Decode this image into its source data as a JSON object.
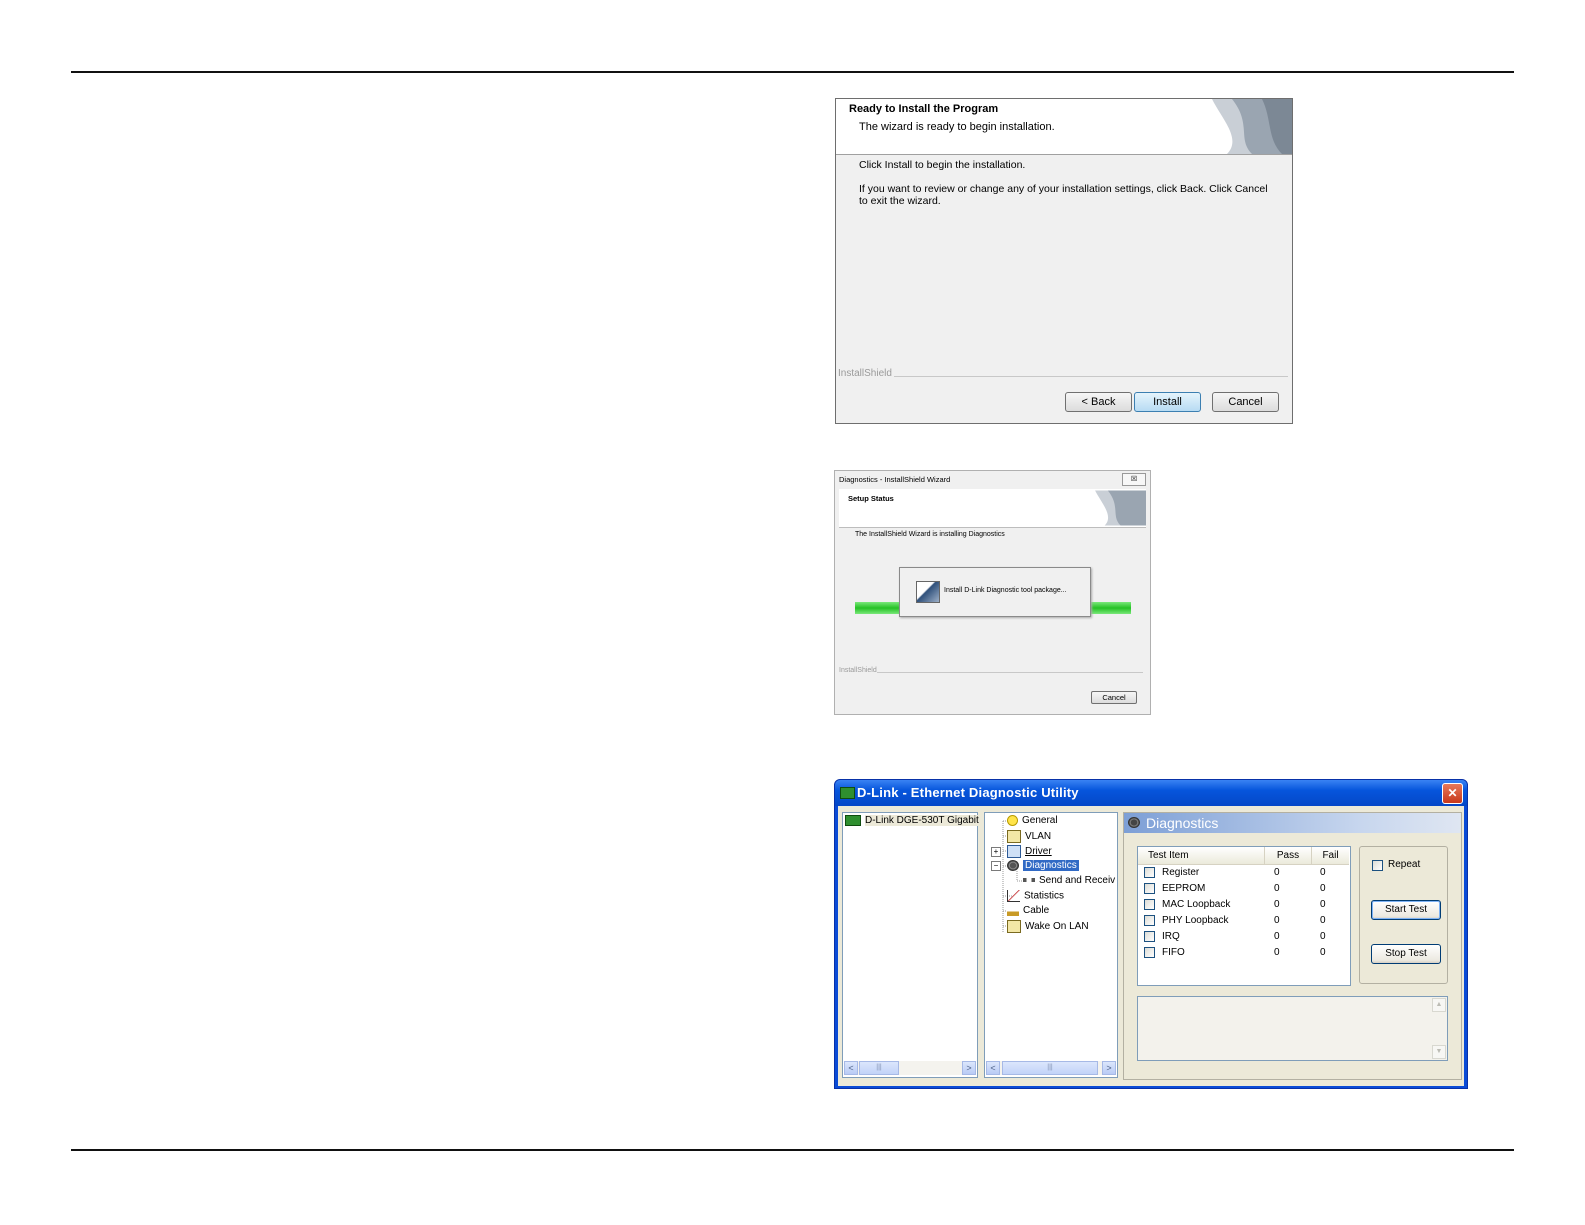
{
  "dialog1": {
    "title": "Ready to Install the Program",
    "subtitle": "The wizard is ready to begin installation.",
    "body_line1": "Click Install to begin the installation.",
    "body_line2": "If you want to review or change any of your installation settings, click Back. Click Cancel to exit the wizard.",
    "brand": "InstallShield",
    "buttons": {
      "back": "< Back",
      "install": "Install",
      "cancel": "Cancel"
    }
  },
  "dialog2": {
    "window_title": "Diagnostics - InstallShield Wizard",
    "close_glyph": "☒",
    "header_title": "Setup Status",
    "status_text": "The InstallShield Wizard is installing Diagnostics",
    "popup_message": "Install D-Link Diagnostic tool package...",
    "brand": "InstallShield",
    "cancel_label": "Cancel"
  },
  "utility": {
    "title": "D-Link - Ethernet Diagnostic Utility",
    "close_glyph": "✕",
    "adapter": "D-Link DGE-530T Gigabit",
    "tree": [
      {
        "label": "General",
        "icon": "bulb-icon"
      },
      {
        "label": "VLAN",
        "icon": "vlan-icon"
      },
      {
        "label": "Driver",
        "icon": "driver-icon",
        "expander": "+"
      },
      {
        "label": "Diagnostics",
        "icon": "diagnostics-icon",
        "expander": "−",
        "selected": true
      },
      {
        "label": "Send and Receiv",
        "icon": "send-receive-icon",
        "child": true
      },
      {
        "label": "Statistics",
        "icon": "statistics-icon"
      },
      {
        "label": "Cable",
        "icon": "cable-icon"
      },
      {
        "label": "Wake On LAN",
        "icon": "wake-on-lan-icon"
      }
    ],
    "panel_title": "Diagnostics",
    "columns": {
      "item": "Test Item",
      "pass": "Pass",
      "fail": "Fail"
    },
    "tests": [
      {
        "name": "Register",
        "pass": "0",
        "fail": "0"
      },
      {
        "name": "EEPROM",
        "pass": "0",
        "fail": "0"
      },
      {
        "name": "MAC Loopback",
        "pass": "0",
        "fail": "0"
      },
      {
        "name": "PHY Loopback",
        "pass": "0",
        "fail": "0"
      },
      {
        "name": "IRQ",
        "pass": "0",
        "fail": "0"
      },
      {
        "name": "FIFO",
        "pass": "0",
        "fail": "0"
      }
    ],
    "repeat_label": "Repeat",
    "start_label": "Start Test",
    "stop_label": "Stop Test",
    "scroll_grip": "|||",
    "arrow_left": "<",
    "arrow_right": ">",
    "arrow_up": "▲",
    "arrow_down": "▼"
  }
}
